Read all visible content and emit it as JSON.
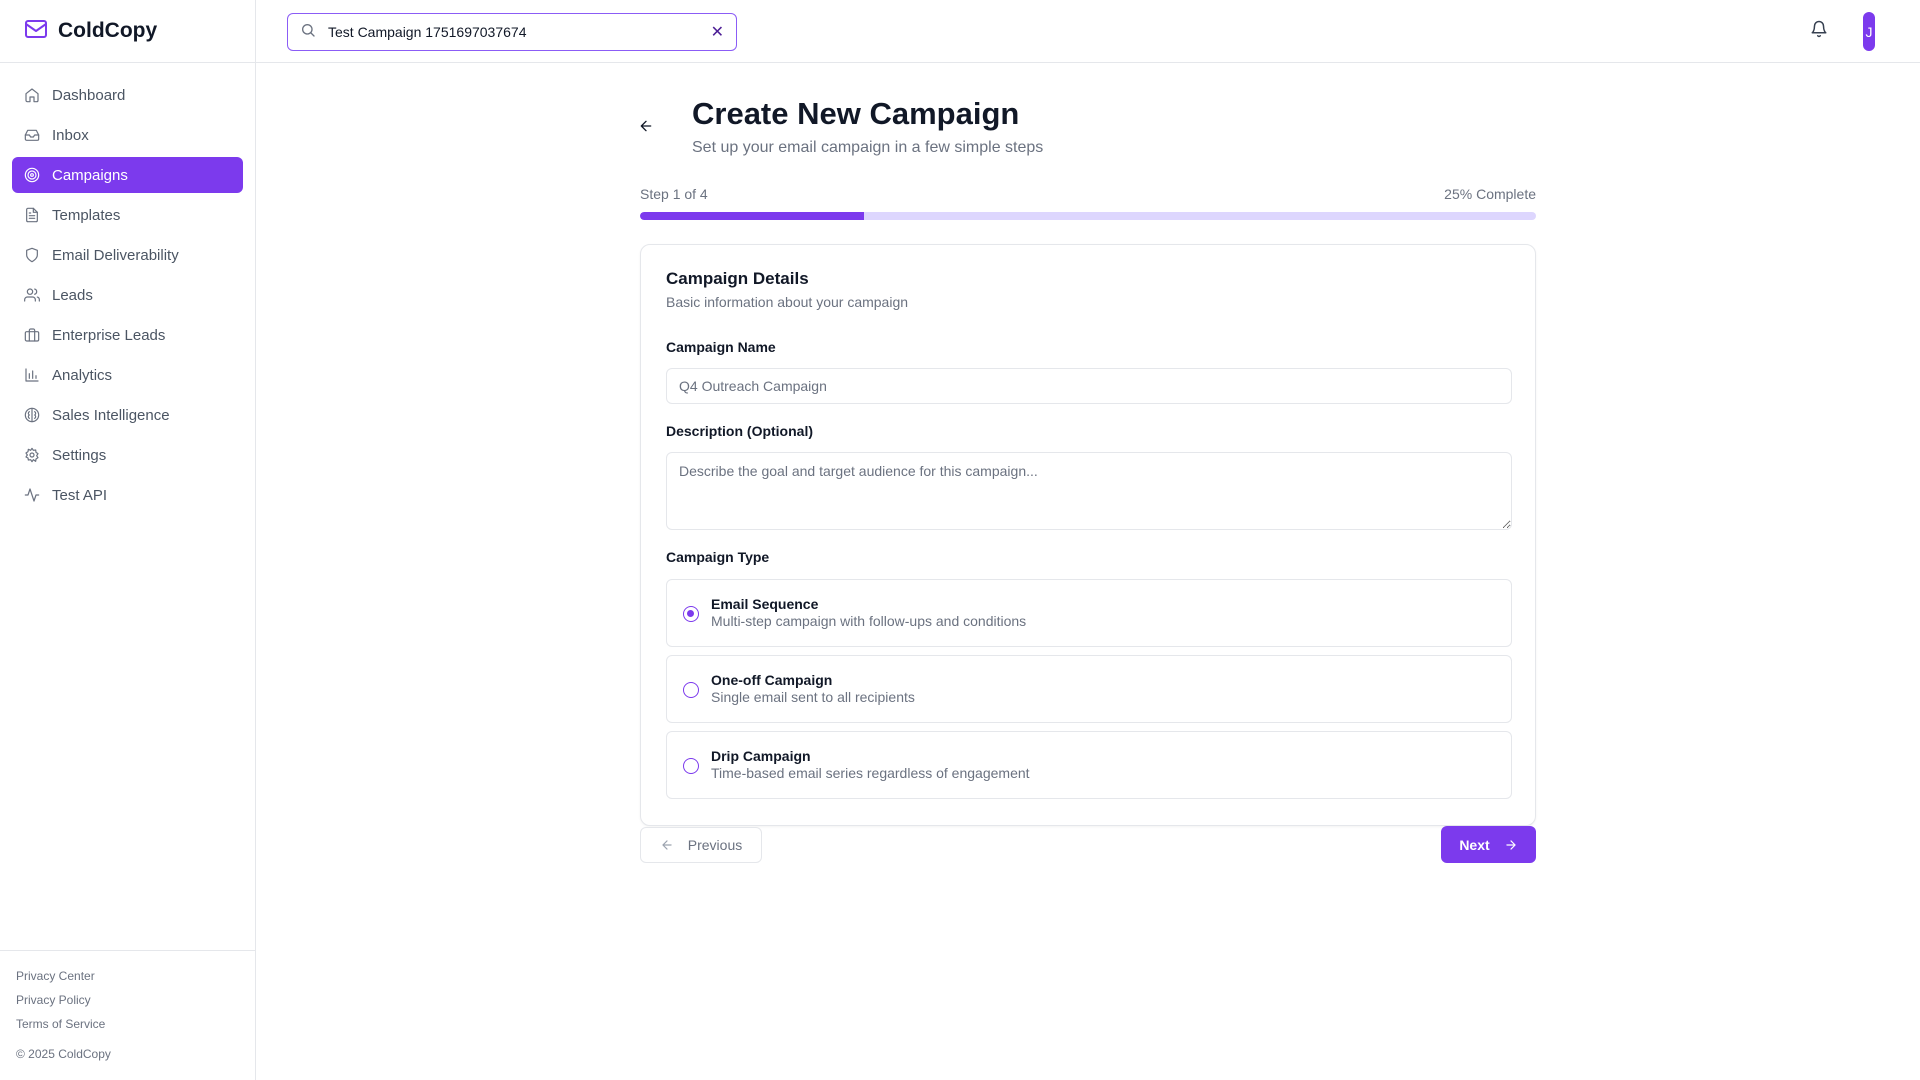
{
  "app": {
    "brand_name": "ColdCopy",
    "brand_icon": "mail-icon",
    "accent_color": "#7c3aed"
  },
  "sidebar": {
    "items": [
      {
        "label": "Dashboard",
        "icon": "home-icon",
        "active": false
      },
      {
        "label": "Inbox",
        "icon": "inbox-icon",
        "active": false
      },
      {
        "label": "Campaigns",
        "icon": "target-icon",
        "active": true
      },
      {
        "label": "Templates",
        "icon": "file-text-icon",
        "active": false
      },
      {
        "label": "Email Deliverability",
        "icon": "shield-icon",
        "active": false
      },
      {
        "label": "Leads",
        "icon": "users-icon",
        "active": false
      },
      {
        "label": "Enterprise Leads",
        "icon": "briefcase-icon",
        "active": false
      },
      {
        "label": "Analytics",
        "icon": "bar-chart-icon",
        "active": false
      },
      {
        "label": "Sales Intelligence",
        "icon": "brain-icon",
        "active": false
      },
      {
        "label": "Settings",
        "icon": "gear-icon",
        "active": false
      },
      {
        "label": "Test API",
        "icon": "activity-icon",
        "active": false
      }
    ],
    "footer": {
      "links": [
        "Privacy Center",
        "Privacy Policy",
        "Terms of Service"
      ],
      "copyright": "© 2025 ColdCopy"
    }
  },
  "header": {
    "search_value": "Test Campaign 1751697037674",
    "avatar_initial": "J"
  },
  "page": {
    "title": "Create New Campaign",
    "subtitle": "Set up your email campaign in a few simple steps",
    "step_text": "Step 1 of 4",
    "complete_text": "25% Complete",
    "progress_fraction": 0.25
  },
  "card": {
    "title": "Campaign Details",
    "subtitle": "Basic information about your campaign",
    "name_label": "Campaign Name",
    "name_placeholder": "Q4 Outreach Campaign",
    "description_label": "Description (Optional)",
    "description_placeholder": "Describe the goal and target audience for this campaign...",
    "type_label": "Campaign Type",
    "options": [
      {
        "title": "Email Sequence",
        "description": "Multi-step campaign with follow-ups and conditions",
        "selected": true
      },
      {
        "title": "One-off Campaign",
        "description": "Single email sent to all recipients",
        "selected": false
      },
      {
        "title": "Drip Campaign",
        "description": "Time-based email series regardless of engagement",
        "selected": false
      }
    ]
  },
  "actions": {
    "previous_label": "Previous",
    "next_label": "Next"
  }
}
